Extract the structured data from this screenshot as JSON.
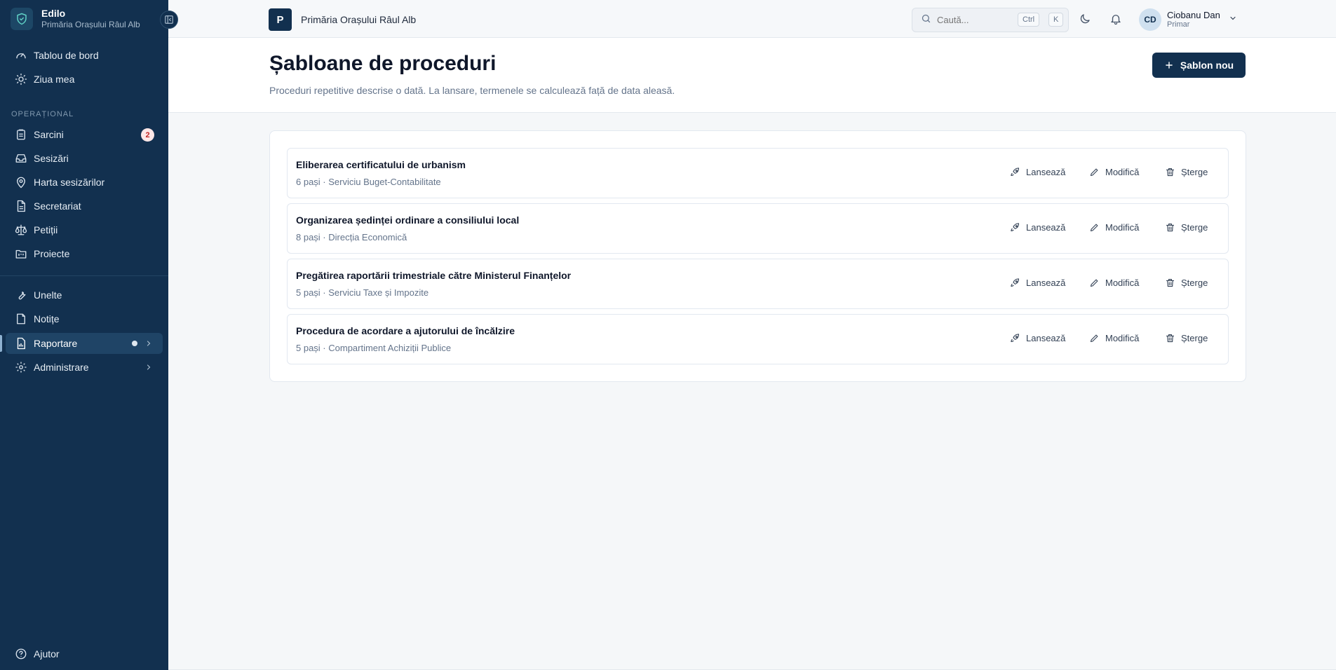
{
  "brand": {
    "name": "Edilo",
    "subtitle": "Primăria Orașului Râul Alb"
  },
  "sidebar": {
    "top_items": [
      {
        "label": "Tablou de bord",
        "icon": "gauge-icon"
      },
      {
        "label": "Ziua mea",
        "icon": "sun-icon"
      }
    ],
    "section_label": "OPERAȚIONAL",
    "operational_items": [
      {
        "label": "Sarcini",
        "icon": "clipboard-icon",
        "badge": "2"
      },
      {
        "label": "Sesizări",
        "icon": "inbox-icon"
      },
      {
        "label": "Harta sesizărilor",
        "icon": "map-pin-icon"
      },
      {
        "label": "Secretariat",
        "icon": "file-text-icon"
      },
      {
        "label": "Petiții",
        "icon": "scale-icon"
      },
      {
        "label": "Proiecte",
        "icon": "folder-kanban-icon"
      }
    ],
    "tool_items": [
      {
        "label": "Unelte",
        "icon": "wrench-icon"
      },
      {
        "label": "Notițe",
        "icon": "note-icon"
      },
      {
        "label": "Raportare",
        "icon": "report-icon",
        "active": true
      },
      {
        "label": "Administrare",
        "icon": "gear-icon"
      }
    ],
    "help_label": "Ajutor"
  },
  "topbar": {
    "org_initial": "P",
    "org_name": "Primăria Orașului Râul Alb",
    "search_placeholder": "Caută...",
    "kbd_ctrl": "Ctrl",
    "kbd_k": "K",
    "user": {
      "initials": "CD",
      "name": "Ciobanu Dan",
      "role": "Primar"
    }
  },
  "header": {
    "title": "Șabloane de proceduri",
    "description": "Proceduri repetitive descrise o dată. La lansare, termenele se calculează față de data aleasă.",
    "new_button": "Șablon nou"
  },
  "actions": {
    "launch": "Lansează",
    "edit": "Modifică",
    "delete": "Șterge"
  },
  "templates": [
    {
      "title": "Eliberarea certificatului de urbanism",
      "meta": "6 pași · Serviciu Buget-Contabilitate"
    },
    {
      "title": "Organizarea ședinței ordinare a consiliului local",
      "meta": "8 pași · Direcția Economică"
    },
    {
      "title": "Pregătirea raportării trimestriale către Ministerul Finanțelor",
      "meta": "5 pași · Serviciu Taxe și Impozite"
    },
    {
      "title": "Procedura de acordare a ajutorului de încălzire",
      "meta": "5 pași · Compartiment Achiziții Publice"
    }
  ],
  "colors": {
    "sidebar": "#12304f",
    "primary": "#12304f",
    "badge_text": "#c02626"
  }
}
